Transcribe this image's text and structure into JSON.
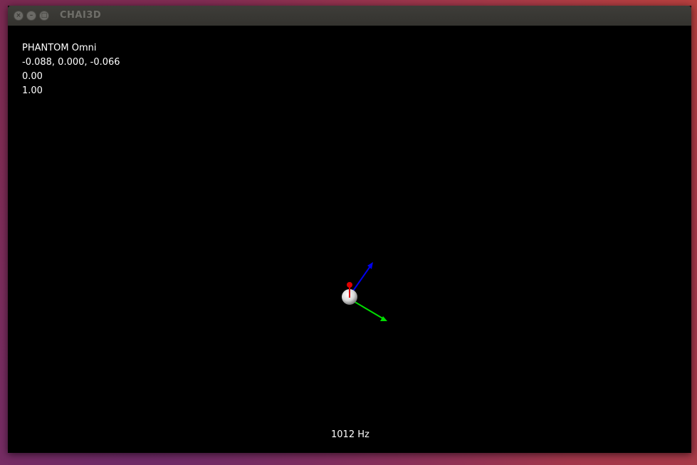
{
  "window": {
    "title": "CHAI3D"
  },
  "overlay": {
    "device_name": "PHANTOM Omni",
    "position": "-0.088, 0.000, -0.066",
    "value_1": "0.00",
    "value_2": "1.00"
  },
  "status": {
    "haptic_rate": "1012 Hz"
  },
  "colors": {
    "background": "#000000",
    "axis_x": "#e00000",
    "axis_y": "#00dd00",
    "axis_z": "#0000ee",
    "cursor": "#e6e6e6"
  }
}
